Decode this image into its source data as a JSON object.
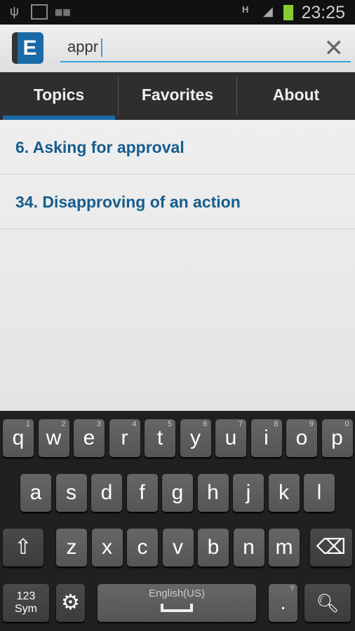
{
  "status": {
    "time": "23:25",
    "network": "H"
  },
  "search": {
    "value": "appr"
  },
  "app": {
    "logo": "E"
  },
  "tabs": [
    "Topics",
    "Favorites",
    "About"
  ],
  "results": [
    "6. Asking for approval",
    "34. Disapproving of an action"
  ],
  "keyboard": {
    "row1": [
      [
        "q",
        "1"
      ],
      [
        "w",
        "2"
      ],
      [
        "e",
        "3"
      ],
      [
        "r",
        "4"
      ],
      [
        "t",
        "5"
      ],
      [
        "y",
        "6"
      ],
      [
        "u",
        "7"
      ],
      [
        "i",
        "8"
      ],
      [
        "o",
        "9"
      ],
      [
        "p",
        "0"
      ]
    ],
    "row2": [
      "a",
      "s",
      "d",
      "f",
      "g",
      "h",
      "j",
      "k",
      "l"
    ],
    "row3": [
      "z",
      "x",
      "c",
      "v",
      "b",
      "n",
      "m"
    ],
    "sym_label": "123\nSym",
    "space_label": "English(US)",
    "period": ".",
    "period_hint": "?"
  },
  "colors": {
    "accent": "#33a5d9",
    "link": "#155d8e",
    "tab_indicator": "#1a6aa8"
  }
}
